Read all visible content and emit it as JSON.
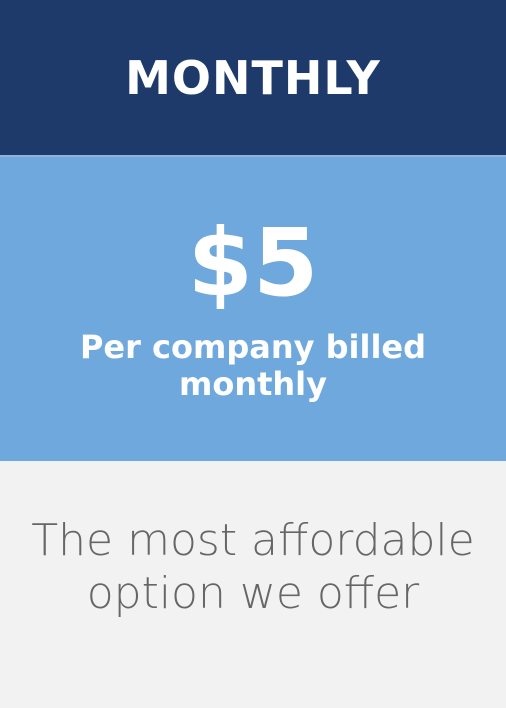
{
  "plan": {
    "name": "MONTHLY",
    "price": "$5",
    "billing_note": "Per company billed monthly",
    "description": "The most affordable option we offer"
  },
  "colors": {
    "header_bg": "#1e3a6b",
    "price_bg": "#6fa8dc",
    "body_bg": "#f2f2f2",
    "text_light": "#ffffff",
    "text_muted": "#666666"
  }
}
